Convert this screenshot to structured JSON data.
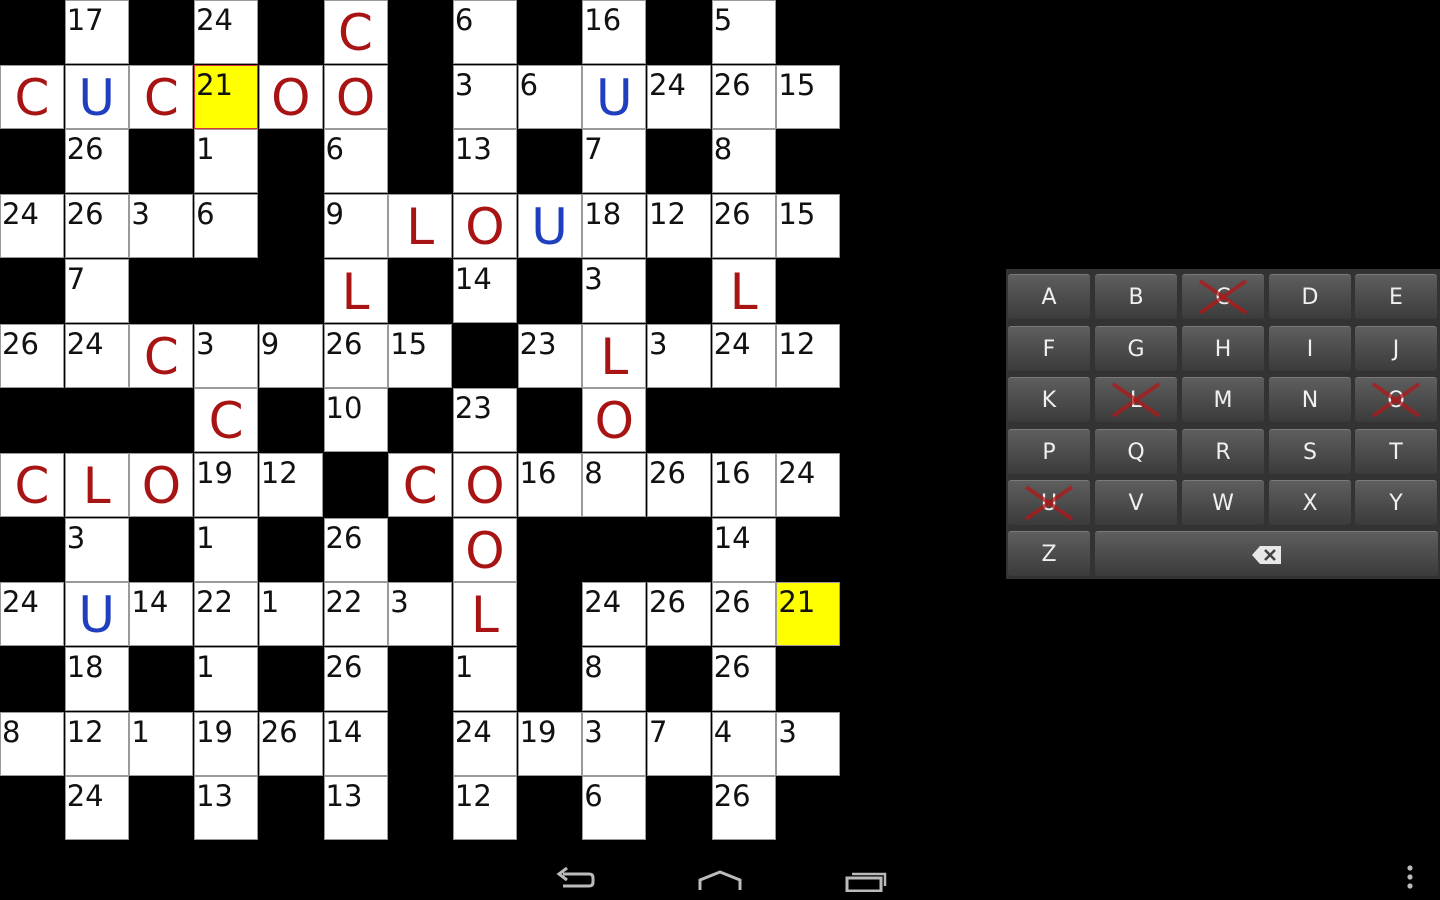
{
  "grid": {
    "size": 13,
    "rows": [
      [
        "#",
        "17",
        "#",
        "24",
        "#",
        "C",
        "#",
        "6",
        "#",
        "16",
        "#",
        "5",
        "#"
      ],
      [
        "C",
        "U",
        "C",
        "21",
        "O",
        "O",
        "#",
        "3",
        "6",
        "U",
        "24",
        "26",
        "15"
      ],
      [
        "#",
        "26",
        "#",
        "1",
        "#",
        "6",
        "#",
        "13",
        "#",
        "7",
        "#",
        "8",
        "#"
      ],
      [
        "24",
        "26",
        "3",
        "6",
        "#",
        "9",
        "L",
        "O",
        "U",
        "18",
        "12",
        "26",
        "15"
      ],
      [
        "#",
        "7",
        "#",
        "#",
        "#",
        "L",
        "#",
        "14",
        "#",
        "3",
        "#",
        "L",
        "#"
      ],
      [
        "26",
        "24",
        "C",
        "3",
        "9",
        "26",
        "15",
        "#",
        "23",
        "L",
        "3",
        "24",
        "12"
      ],
      [
        "#",
        "#",
        "#",
        "C",
        "#",
        "10",
        "#",
        "23",
        "#",
        "O",
        "#",
        "#",
        "#"
      ],
      [
        "C",
        "L",
        "O",
        "19",
        "12",
        "#",
        "C",
        "O",
        "16",
        "8",
        "26",
        "16",
        "24"
      ],
      [
        "#",
        "3",
        "#",
        "1",
        "#",
        "26",
        "#",
        "O",
        "#",
        "#",
        "#",
        "14",
        "#"
      ],
      [
        "24",
        "U",
        "14",
        "22",
        "1",
        "22",
        "3",
        "L",
        "#",
        "24",
        "26",
        "26",
        "21"
      ],
      [
        "#",
        "18",
        "#",
        "1",
        "#",
        "26",
        "#",
        "1",
        "#",
        "8",
        "#",
        "26",
        "#"
      ],
      [
        "8",
        "12",
        "1",
        "19",
        "26",
        "14",
        "#",
        "24",
        "19",
        "3",
        "7",
        "4",
        "3"
      ],
      [
        "#",
        "24",
        "#",
        "13",
        "#",
        "13",
        "#",
        "12",
        "#",
        "6",
        "#",
        "26",
        "#"
      ]
    ],
    "highlighted_number": "21",
    "selected_cell": {
      "row": 1,
      "col": 3
    },
    "letter_colors": {
      "C": "#a81313",
      "O": "#a81313",
      "L": "#a81313",
      "U": "#1f3fbf"
    }
  },
  "keyboard": {
    "rows": [
      [
        "A",
        "B",
        "C",
        "D",
        "E"
      ],
      [
        "F",
        "G",
        "H",
        "I",
        "J"
      ],
      [
        "K",
        "L",
        "M",
        "N",
        "O"
      ],
      [
        "P",
        "Q",
        "R",
        "S",
        "T"
      ],
      [
        "U",
        "V",
        "W",
        "X",
        "Y"
      ],
      [
        "Z"
      ]
    ],
    "used_letters": [
      "C",
      "L",
      "O",
      "U"
    ],
    "backspace_icon": "backspace-icon",
    "cross_color": "#b01818"
  },
  "navigation": {
    "icons": [
      "back-icon",
      "home-icon",
      "recent-apps-icon",
      "overflow-menu-icon"
    ]
  }
}
